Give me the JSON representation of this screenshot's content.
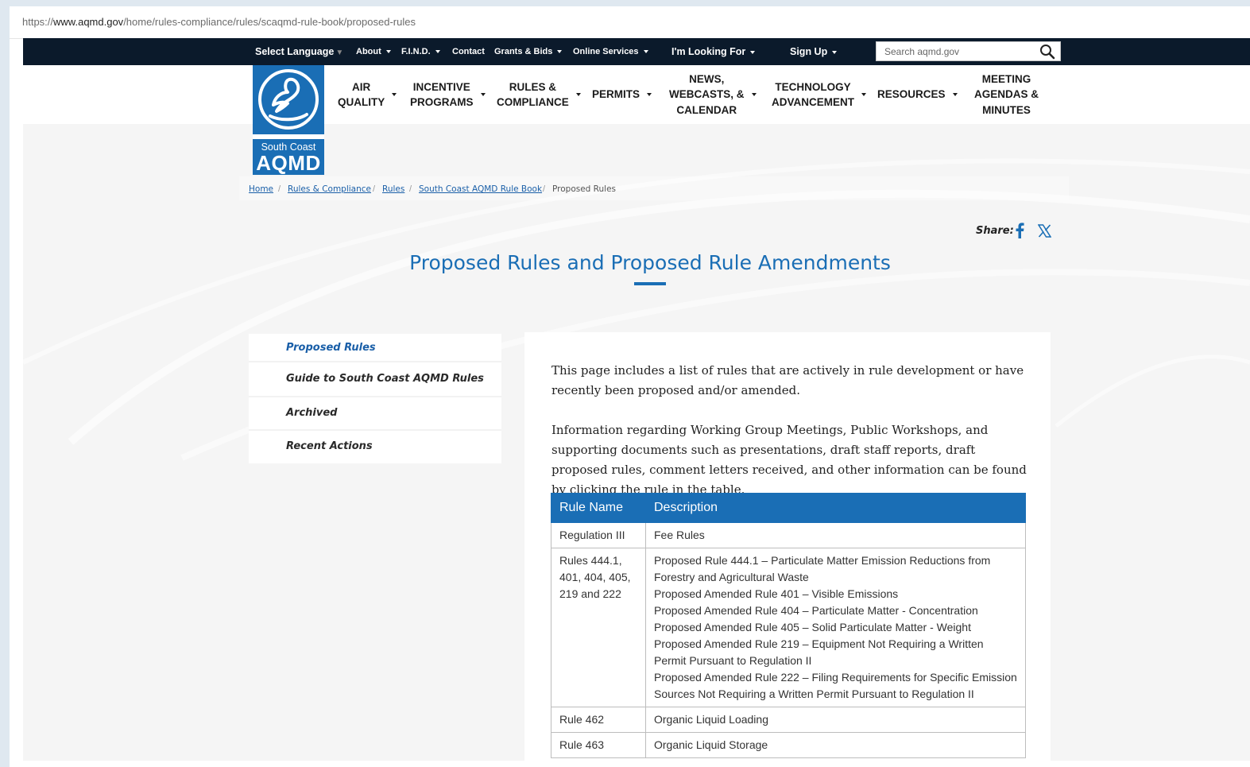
{
  "browser": {
    "url_prefix": "https://",
    "url_host": "www.aqmd.gov",
    "url_path": "/home/rules-compliance/rules/scaqmd-rule-book/proposed-rules"
  },
  "topbar": {
    "select_language": "Select Language",
    "about": "About",
    "find": "F.I.N.D.",
    "contact": "Contact",
    "grants": "Grants & Bids",
    "online_services": "Online Services",
    "looking_for": "I'm Looking For",
    "sign_up": "Sign Up",
    "search_placeholder": "Search aqmd.gov"
  },
  "logo": {
    "line1": "South Coast",
    "line2": "AQMD"
  },
  "main_nav": [
    {
      "line1": "AIR",
      "line2": "QUALITY"
    },
    {
      "line1": "INCENTIVE",
      "line2": "PROGRAMS"
    },
    {
      "line1": "RULES &",
      "line2": "COMPLIANCE"
    },
    {
      "line1": "PERMITS"
    },
    {
      "line1": "NEWS,",
      "line2": "WEBCASTS, &",
      "line3": "CALENDAR"
    },
    {
      "line1": "TECHNOLOGY",
      "line2": "ADVANCEMENT"
    },
    {
      "line1": "RESOURCES"
    },
    {
      "line1": "MEETING",
      "line2": "AGENDAS &",
      "line3": "MINUTES"
    }
  ],
  "breadcrumb": {
    "home": "Home",
    "rules_compliance": "Rules & Compliance",
    "rules": "Rules",
    "rule_book": "South Coast AQMD Rule Book",
    "current": "Proposed Rules",
    "separator": "/"
  },
  "share": {
    "label": "Share:"
  },
  "page_title": "Proposed Rules and Proposed Rule Amendments",
  "sidenav": [
    "Proposed Rules",
    "Guide to South Coast AQMD Rules",
    "Archived",
    "Recent Actions"
  ],
  "intro": {
    "p1": "This page includes a list of rules that are actively in rule development or have recently been proposed and/or amended.",
    "p2": "Information regarding Working Group Meetings, Public Workshops, and supporting documents such as presentations, draft staff reports, draft proposed rules, comment letters received, and other information can be found by clicking the rule in the table."
  },
  "table": {
    "headers": [
      "Rule Name",
      "Description"
    ],
    "rows": [
      {
        "name": "Regulation III",
        "desc": [
          "Fee Rules"
        ]
      },
      {
        "name": "Rules 444.1, 401, 404, 405, 219 and 222",
        "desc": [
          "Proposed Rule 444.1 – Particulate Matter Emission Reductions from Forestry and Agricultural Waste",
          "Proposed Amended Rule 401 – Visible Emissions",
          "Proposed Amended Rule 404 – Particulate Matter - Concentration",
          "Proposed Amended Rule 405 – Solid Particulate Matter - Weight",
          "Proposed Amended Rule 219 – Equipment Not Requiring a Written Permit Pursuant to Regulation II",
          "Proposed Amended Rule 222 – Filing Requirements for Specific Emission Sources Not Requiring a Written Permit Pursuant to Regulation II"
        ]
      },
      {
        "name": "Rule 462",
        "desc": [
          "Organic Liquid Loading"
        ]
      },
      {
        "name": "Rule 463",
        "desc": [
          "Organic Liquid Storage"
        ]
      }
    ]
  },
  "colors": {
    "brand_blue": "#1a6eb5",
    "topbar_bg": "#0b1a2b",
    "link": "#1a5fa8"
  },
  "icons": [
    "search-icon",
    "facebook-icon",
    "x-icon",
    "dove-logo-icon",
    "chevron-down-icon"
  ]
}
